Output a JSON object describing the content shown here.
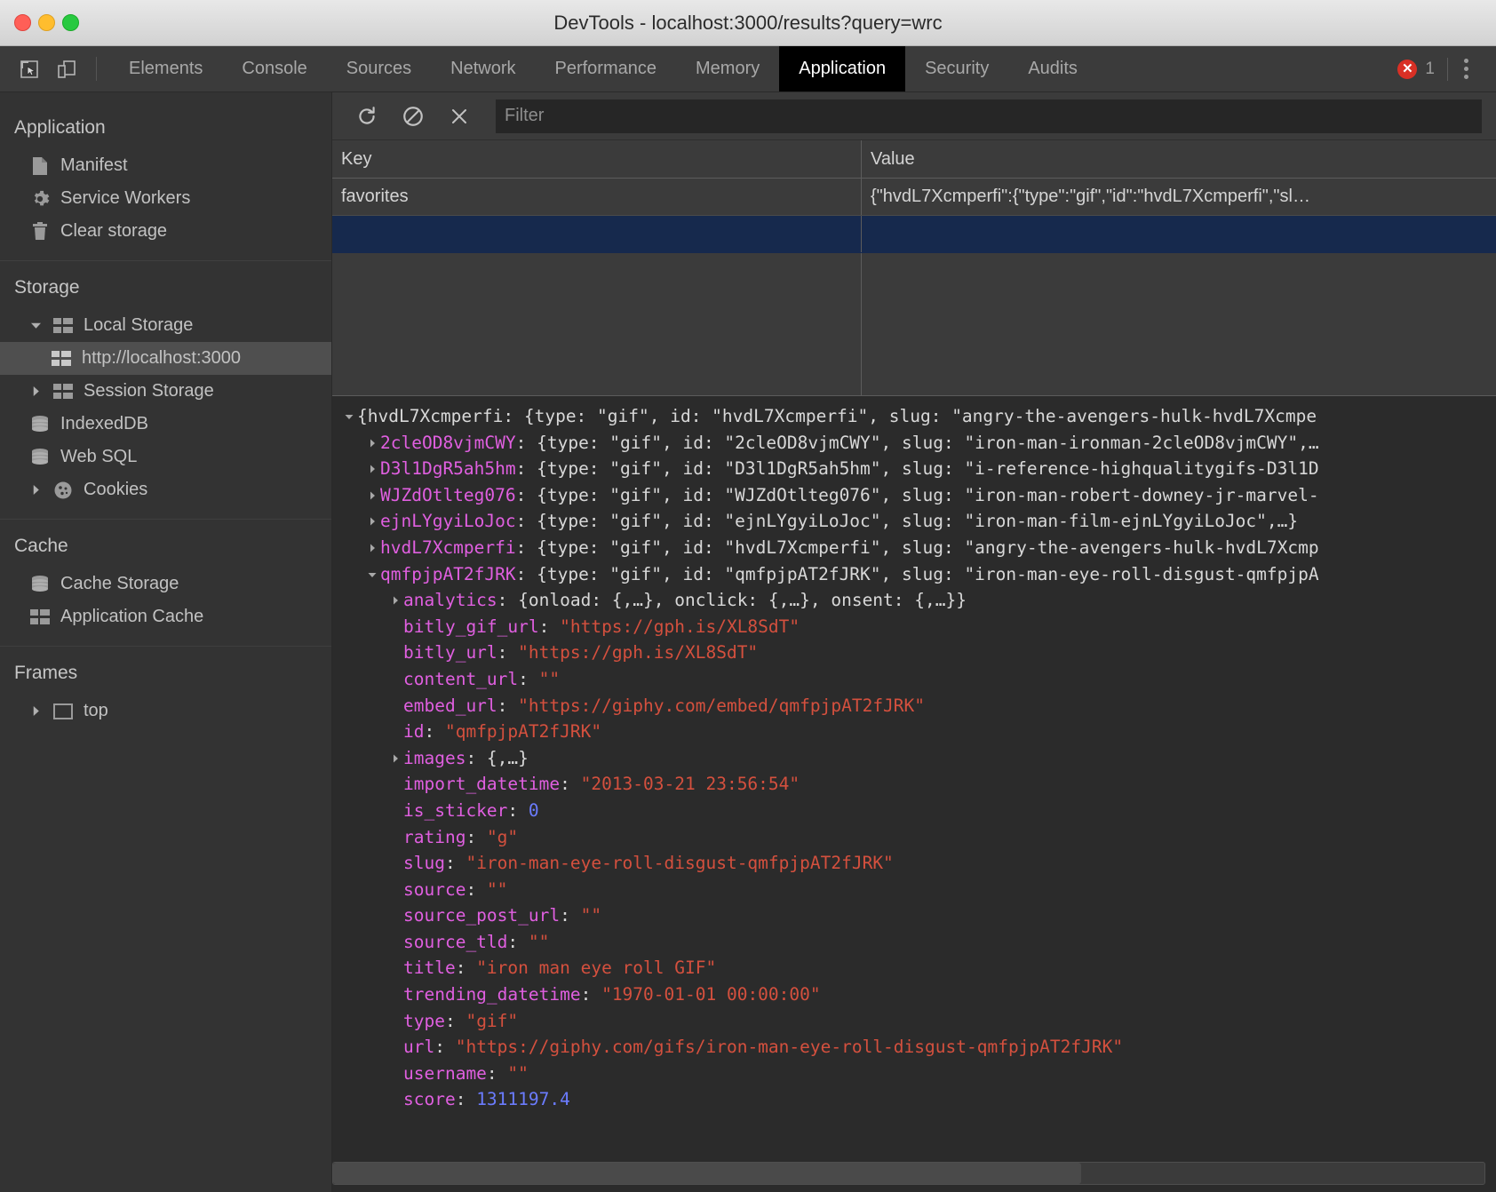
{
  "window": {
    "title": "DevTools - localhost:3000/results?query=wrc",
    "traffic": {
      "close": "close-button",
      "minimize": "minimize-button",
      "zoom": "zoom-button"
    }
  },
  "tabbar": {
    "inspect_icon": "inspect-element-icon",
    "device_icon": "device-toolbar-icon",
    "tabs": [
      {
        "label": "Elements",
        "active": false
      },
      {
        "label": "Console",
        "active": false
      },
      {
        "label": "Sources",
        "active": false
      },
      {
        "label": "Network",
        "active": false
      },
      {
        "label": "Performance",
        "active": false
      },
      {
        "label": "Memory",
        "active": false
      },
      {
        "label": "Application",
        "active": true
      },
      {
        "label": "Security",
        "active": false
      },
      {
        "label": "Audits",
        "active": false
      }
    ],
    "error_count": "1",
    "error_color": "#d93025",
    "menu_icon": "more-options-icon"
  },
  "sidebar": {
    "sections": [
      {
        "title": "Application",
        "items": [
          {
            "label": "Manifest",
            "icon": "document-icon",
            "indent": 1,
            "arrow": "none",
            "selected": false
          },
          {
            "label": "Service Workers",
            "icon": "gear-icon",
            "indent": 1,
            "arrow": "none",
            "selected": false
          },
          {
            "label": "Clear storage",
            "icon": "trash-icon",
            "indent": 1,
            "arrow": "none",
            "selected": false
          }
        ]
      },
      {
        "title": "Storage",
        "items": [
          {
            "label": "Local Storage",
            "icon": "table-icon",
            "indent": 1,
            "arrow": "down",
            "selected": false
          },
          {
            "label": "http://localhost:3000",
            "icon": "table-icon",
            "indent": 2,
            "arrow": "none",
            "selected": true
          },
          {
            "label": "Session Storage",
            "icon": "table-icon",
            "indent": 1,
            "arrow": "right",
            "selected": false
          },
          {
            "label": "IndexedDB",
            "icon": "database-icon",
            "indent": 1,
            "arrow": "none",
            "selected": false
          },
          {
            "label": "Web SQL",
            "icon": "database-icon",
            "indent": 1,
            "arrow": "none",
            "selected": false
          },
          {
            "label": "Cookies",
            "icon": "cookie-icon",
            "indent": 1,
            "arrow": "right",
            "selected": false
          }
        ]
      },
      {
        "title": "Cache",
        "items": [
          {
            "label": "Cache Storage",
            "icon": "database-icon",
            "indent": 1,
            "arrow": "none",
            "selected": false
          },
          {
            "label": "Application Cache",
            "icon": "table-icon",
            "indent": 1,
            "arrow": "none",
            "selected": false
          }
        ]
      },
      {
        "title": "Frames",
        "items": [
          {
            "label": "top",
            "icon": "frame-icon",
            "indent": 1,
            "arrow": "right",
            "selected": false
          }
        ]
      }
    ]
  },
  "toolbar": {
    "refresh_icon": "refresh-icon",
    "clear_all_icon": "clear-all-icon",
    "delete_icon": "delete-selected-icon",
    "filter_placeholder": "Filter",
    "filter_value": ""
  },
  "grid": {
    "columns": [
      "Key",
      "Value"
    ],
    "rows": [
      {
        "key": "favorites",
        "value": "{\"hvdL7Xcmperfi\":{\"type\":\"gif\",\"id\":\"hvdL7Xcmperfi\",\"sl…",
        "selected": false
      },
      {
        "key": "",
        "value": "",
        "selected": true
      }
    ]
  },
  "preview": {
    "lines": [
      {
        "level": 0,
        "arrow": "down",
        "prefix": "{",
        "prop": "hvdL7Xcmperfi",
        "prop_color": "plain",
        "rest": ": {type: \"gif\", id: \"hvdL7Xcmperfi\", slug: \"angry-the-avengers-hulk-hvdL7Xcmpe"
      },
      {
        "level": 1,
        "arrow": "right",
        "prefix": "",
        "prop": "2cleOD8vjmCWY",
        "prop_color": "magenta",
        "rest": ": {type: \"gif\", id: \"2cleOD8vjmCWY\", slug: \"iron-man-ironman-2cleOD8vjmCWY\",…"
      },
      {
        "level": 1,
        "arrow": "right",
        "prefix": "",
        "prop": "D3l1DgR5ah5hm",
        "prop_color": "magenta",
        "rest": ": {type: \"gif\", id: \"D3l1DgR5ah5hm\", slug: \"i-reference-highqualitygifs-D3l1D"
      },
      {
        "level": 1,
        "arrow": "right",
        "prefix": "",
        "prop": "WJZdOtlteg076",
        "prop_color": "magenta",
        "rest": ": {type: \"gif\", id: \"WJZdOtlteg076\", slug: \"iron-man-robert-downey-jr-marvel-"
      },
      {
        "level": 1,
        "arrow": "right",
        "prefix": "",
        "prop": "ejnLYgyiLoJoc",
        "prop_color": "magenta",
        "rest": ": {type: \"gif\", id: \"ejnLYgyiLoJoc\", slug: \"iron-man-film-ejnLYgyiLoJoc\",…}"
      },
      {
        "level": 1,
        "arrow": "right",
        "prefix": "",
        "prop": "hvdL7Xcmperfi",
        "prop_color": "magenta",
        "rest": ": {type: \"gif\", id: \"hvdL7Xcmperfi\", slug: \"angry-the-avengers-hulk-hvdL7Xcmp"
      },
      {
        "level": 1,
        "arrow": "down",
        "prefix": "",
        "prop": "qmfpjpAT2fJRK",
        "prop_color": "magenta",
        "rest": ": {type: \"gif\", id: \"qmfpjpAT2fJRK\", slug: \"iron-man-eye-roll-disgust-qmfpjpA"
      },
      {
        "level": 2,
        "arrow": "right",
        "prefix": "",
        "prop": "analytics",
        "prop_color": "magenta",
        "rest": ": {onload: {,…}, onclick: {,…}, onsent: {,…}}"
      },
      {
        "level": 2,
        "arrow": "none",
        "prefix": "",
        "prop": "bitly_gif_url",
        "prop_color": "magenta",
        "value_str": "https://gph.is/XL8SdT"
      },
      {
        "level": 2,
        "arrow": "none",
        "prefix": "",
        "prop": "bitly_url",
        "prop_color": "magenta",
        "value_str": "https://gph.is/XL8SdT"
      },
      {
        "level": 2,
        "arrow": "none",
        "prefix": "",
        "prop": "content_url",
        "prop_color": "magenta",
        "value_str": ""
      },
      {
        "level": 2,
        "arrow": "none",
        "prefix": "",
        "prop": "embed_url",
        "prop_color": "magenta",
        "value_str": "https://giphy.com/embed/qmfpjpAT2fJRK"
      },
      {
        "level": 2,
        "arrow": "none",
        "prefix": "",
        "prop": "id",
        "prop_color": "magenta",
        "value_str": "qmfpjpAT2fJRK"
      },
      {
        "level": 2,
        "arrow": "right",
        "prefix": "",
        "prop": "images",
        "prop_color": "magenta",
        "rest": ": {,…}"
      },
      {
        "level": 2,
        "arrow": "none",
        "prefix": "",
        "prop": "import_datetime",
        "prop_color": "magenta",
        "value_str": "2013-03-21 23:56:54"
      },
      {
        "level": 2,
        "arrow": "none",
        "prefix": "",
        "prop": "is_sticker",
        "prop_color": "magenta",
        "value_num": "0"
      },
      {
        "level": 2,
        "arrow": "none",
        "prefix": "",
        "prop": "rating",
        "prop_color": "magenta",
        "value_str": "g"
      },
      {
        "level": 2,
        "arrow": "none",
        "prefix": "",
        "prop": "slug",
        "prop_color": "magenta",
        "value_str": "iron-man-eye-roll-disgust-qmfpjpAT2fJRK"
      },
      {
        "level": 2,
        "arrow": "none",
        "prefix": "",
        "prop": "source",
        "prop_color": "magenta",
        "value_str": ""
      },
      {
        "level": 2,
        "arrow": "none",
        "prefix": "",
        "prop": "source_post_url",
        "prop_color": "magenta",
        "value_str": ""
      },
      {
        "level": 2,
        "arrow": "none",
        "prefix": "",
        "prop": "source_tld",
        "prop_color": "magenta",
        "value_str": ""
      },
      {
        "level": 2,
        "arrow": "none",
        "prefix": "",
        "prop": "title",
        "prop_color": "magenta",
        "value_str": "iron man eye roll GIF"
      },
      {
        "level": 2,
        "arrow": "none",
        "prefix": "",
        "prop": "trending_datetime",
        "prop_color": "magenta",
        "value_str": "1970-01-01 00:00:00"
      },
      {
        "level": 2,
        "arrow": "none",
        "prefix": "",
        "prop": "type",
        "prop_color": "magenta",
        "value_str": "gif"
      },
      {
        "level": 2,
        "arrow": "none",
        "prefix": "",
        "prop": "url",
        "prop_color": "magenta",
        "value_str": "https://giphy.com/gifs/iron-man-eye-roll-disgust-qmfpjpAT2fJRK"
      },
      {
        "level": 2,
        "arrow": "none",
        "prefix": "",
        "prop": "username",
        "prop_color": "magenta",
        "value_str": ""
      },
      {
        "level": 2,
        "arrow": "none",
        "prefix": "",
        "prop": "score",
        "prop_color": "magenta",
        "value_num": "1311197.4"
      }
    ],
    "scrollbar": "horizontal-scrollbar"
  }
}
